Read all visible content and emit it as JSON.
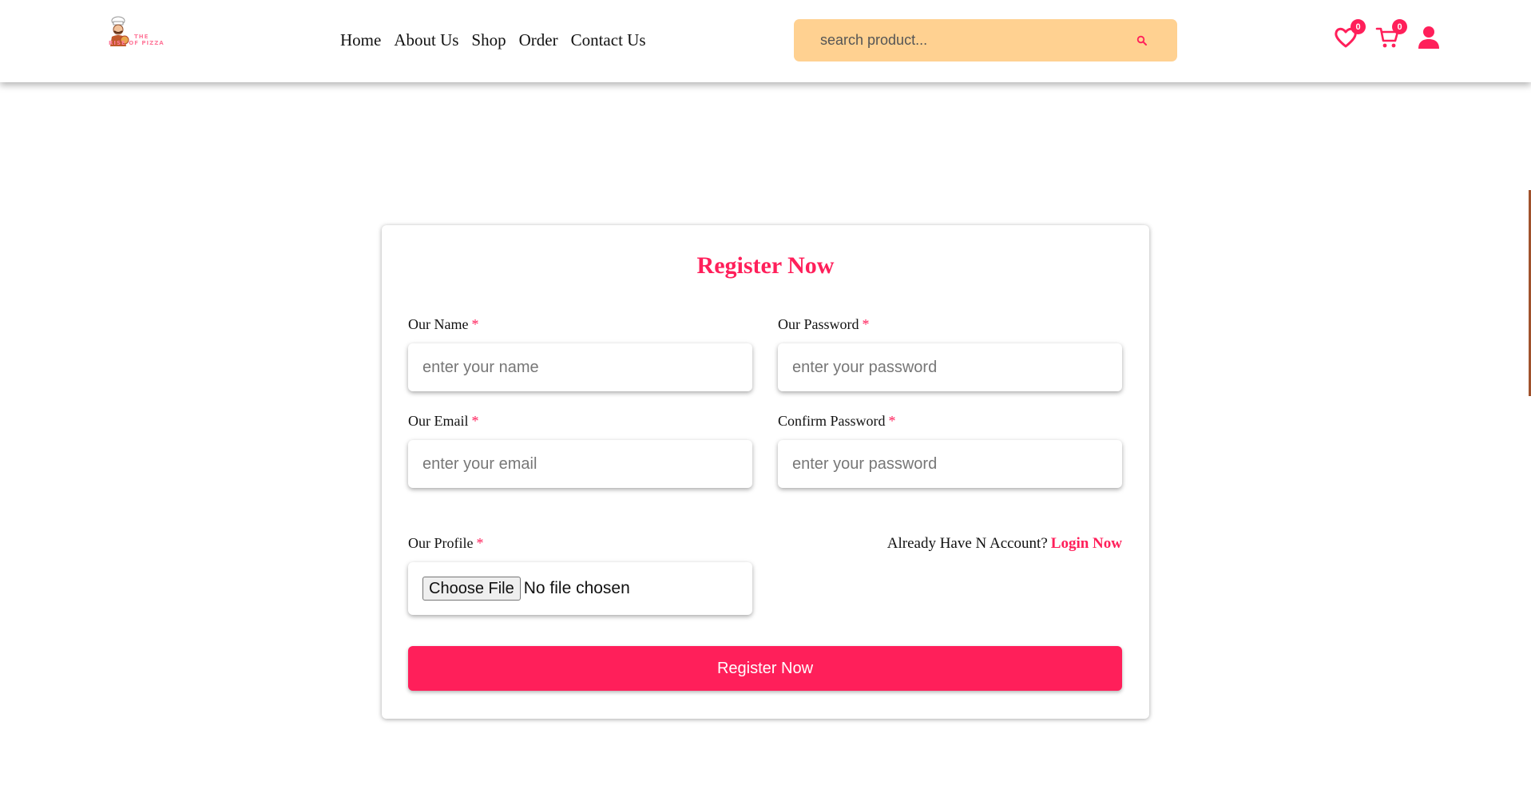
{
  "header": {
    "logo": {
      "line1": "THE",
      "line2": "RISE OF PIZZA",
      "icon": "chef-logo-icon"
    },
    "nav": [
      {
        "label": "Home"
      },
      {
        "label": "About Us"
      },
      {
        "label": "Shop"
      },
      {
        "label": "Order"
      },
      {
        "label": "Contact Us"
      }
    ],
    "search": {
      "placeholder": "search product...",
      "icon": "search-icon"
    },
    "wishlist": {
      "icon": "heart-icon",
      "count": "0"
    },
    "cart": {
      "icon": "cart-icon",
      "count": "0"
    },
    "account": {
      "icon": "user-icon"
    }
  },
  "form": {
    "title": "Register Now",
    "name": {
      "label": "Our Name",
      "required": "*",
      "placeholder": "enter your name"
    },
    "password": {
      "label": "Our Password",
      "required": "*",
      "placeholder": "enter your password"
    },
    "email": {
      "label": "Our Email",
      "required": "*",
      "placeholder": "enter your email"
    },
    "confirm": {
      "label": "Confirm Password",
      "required": "*",
      "placeholder": "enter your password"
    },
    "profile": {
      "label": "Our Profile",
      "required": "*",
      "button": "Choose File",
      "status": "No file chosen"
    },
    "login_prompt": "Already Have N Account?",
    "login_link": "Login Now",
    "submit": "Register Now"
  },
  "colors": {
    "accent": "#ff1f5a",
    "search_bg": "#ffd191",
    "edge_accent": "#a0522d"
  }
}
